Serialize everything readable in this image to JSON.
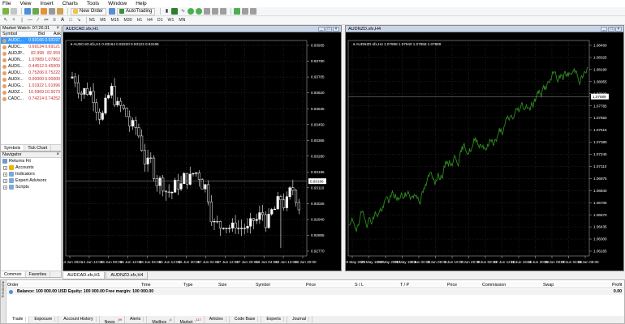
{
  "menu": [
    "File",
    "View",
    "Insert",
    "Charts",
    "Tools",
    "Window",
    "Help"
  ],
  "toolbar": {
    "new_order": "New Order",
    "autotrading": "AutoTrading",
    "timeframes": [
      "M1",
      "M5",
      "M15",
      "M30",
      "H1",
      "H4",
      "D1",
      "W1",
      "MN"
    ]
  },
  "market_watch": {
    "title": "Market Watch: 07:26:31",
    "columns": [
      "Symbol",
      "Bid",
      "Ask"
    ],
    "rows": [
      {
        "symbol": "AUDC...",
        "bid": "0.93166",
        "ask": "0.93197",
        "selected": true
      },
      {
        "symbol": "AUDC...",
        "bid": "0.69134",
        "ask": "0.69121"
      },
      {
        "symbol": "AUDJP...",
        "bid": "82.998",
        "ask": "82.959"
      },
      {
        "symbol": "AUDN...",
        "bid": "1.07889",
        "ask": "1.07862"
      },
      {
        "symbol": "AUDS...",
        "bid": "0.44512",
        "ask": "0.45009"
      },
      {
        "symbol": "AUDU...",
        "bid": "0.75206",
        "ask": "0.75222"
      },
      {
        "symbol": "AUDX...",
        "bid": "0.00000",
        "ask": "0.00000"
      },
      {
        "symbol": "AUDG...",
        "bid": "1.01922",
        "ask": "1.01996"
      },
      {
        "symbol": "AUDZ...",
        "bid": "10.5969",
        "ask": "10.5073"
      },
      {
        "symbol": "CADC...",
        "bid": "0.74214",
        "ask": "0.74252"
      }
    ],
    "tabs": [
      "Symbols",
      "Tick Chart"
    ]
  },
  "navigator": {
    "title": "Navigator",
    "root": "Returns Fit",
    "items": [
      "Accounts",
      "Indicators",
      "Expert Advisors",
      "Scripts"
    ],
    "tabs": [
      "Common",
      "Favorites"
    ]
  },
  "chart1": {
    "title": "AUDCAD.sfx,H1",
    "info": "AUDCAD.sfx,H1 0.93164 0.93220 0.93123 0.93166",
    "prices": [
      "0.93935",
      "0.93790",
      "0.93705",
      "0.93620",
      "0.93535",
      "0.93450",
      "0.93365",
      "0.93280",
      "0.93195",
      "0.93110",
      "0.93025",
      "0.92940",
      "0.92855",
      "0.92770"
    ],
    "last_price": "0.93166",
    "time_labels": [
      "14 Jun 2021",
      "14 Jun 12:00",
      "15 Jun 00:00",
      "15 Jun 12:00",
      "16 Jun 04:00",
      "16 Jun 12:00",
      "16 Jun 20:00",
      "17 Jun 04:00",
      "17 Jun 12:00",
      "17 Jun 20:00",
      "18 Jun 04:00",
      "18 Jun 12:00",
      "18 Jun 20:00"
    ]
  },
  "chart2": {
    "title": "AUDNZD.sfx,H4",
    "info": "AUDNZD.sfx,H4 1.07888 1.07940 1.07858 1.07889",
    "prices": [
      "1.08460",
      "1.08325",
      "1.08190",
      "1.08055",
      "1.07920",
      "1.07785",
      "1.07650",
      "1.07515",
      "1.07380",
      "1.07245",
      "1.07110",
      "1.06975",
      "1.06840",
      "1.06705",
      "1.06570",
      "1.06435",
      "1.06300",
      "1.06165"
    ],
    "last_price": "1.07889",
    "time_labels": [
      "26 May 2021",
      "27 May 16:00",
      "28 May 20:00",
      "31 May 16:00",
      "2 Jun 00:00",
      "3 Jun 08:00",
      "4 Jun 16:00",
      "7 Jun 20:00",
      "9 Jun 08:00",
      "10 Jun 12:00",
      "11 Jun 16:00",
      "14 Jun 20:00",
      "16 Jun 00:00",
      "17 Jun 04:00",
      "18 Jun 08:00"
    ]
  },
  "chart_tabs": [
    "AUDCAD.sfx,H1",
    "AUDNZD.sfx,H4"
  ],
  "terminal": {
    "columns": [
      "Order",
      "Time",
      "Type",
      "Size",
      "Symbol",
      "Price",
      "S / L",
      "T / P",
      "Price",
      "Commission",
      "Swap",
      "Profit"
    ],
    "balance": "Balance: 100 000.00 USD  Equity: 100 000.00  Free margin: 100 000.00",
    "profit": "0.00",
    "side_label": "Terminal",
    "tabs": [
      {
        "label": "Trade",
        "active": true
      },
      {
        "label": "Exposure"
      },
      {
        "label": "Account History"
      },
      {
        "label": "News",
        "badge": "99"
      },
      {
        "label": "Alerts"
      },
      {
        "label": "Mailbox",
        "badge": "6"
      },
      {
        "label": "Market",
        "badge": "117"
      },
      {
        "label": "Articles"
      },
      {
        "label": "Code Base"
      },
      {
        "label": "Experts"
      },
      {
        "label": "Journal"
      }
    ]
  },
  "colors": {
    "bull_candle": "#ffffff",
    "bear_candle": "#000000",
    "line_green": "#2e8b1e",
    "selection": "#3399ff",
    "chart_bg": "#000000"
  }
}
